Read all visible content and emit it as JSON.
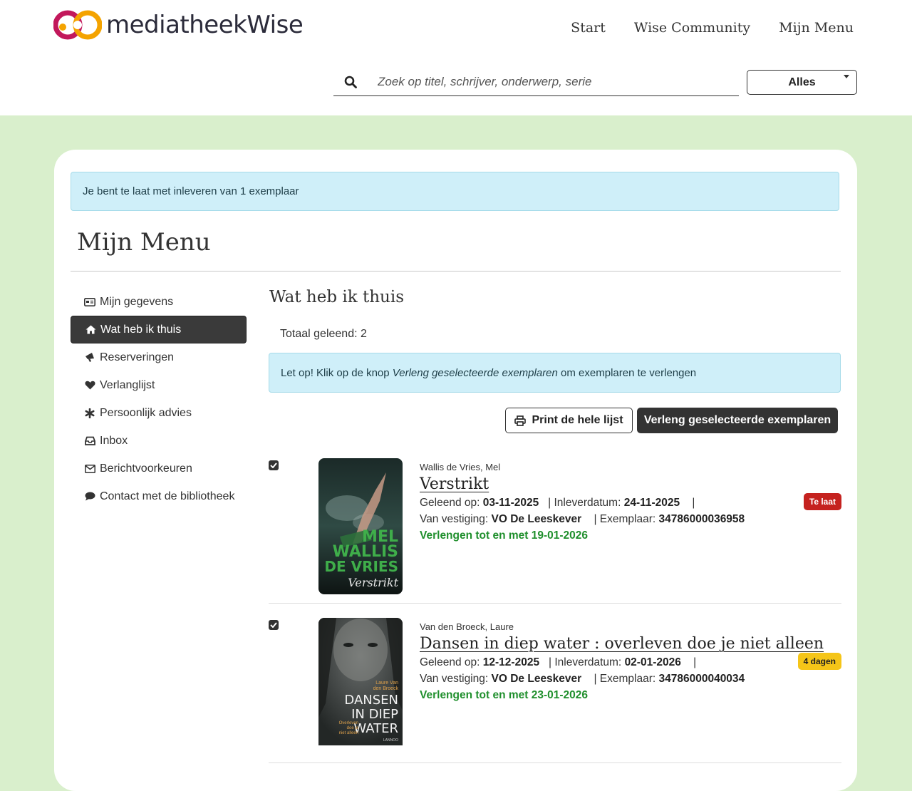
{
  "header": {
    "logo_text": "mediatheekWise",
    "nav": [
      "Start",
      "Wise Community",
      "Mijn Menu"
    ],
    "search_placeholder": "Zoek op titel, schrijver, onderwerp, serie",
    "filter_value": "Alles"
  },
  "alert_top": "Je bent te laat met inleveren van 1 exemplaar",
  "page_title": "Mijn Menu",
  "sidebar": [
    {
      "label": "Mijn gegevens",
      "icon": "id-card-icon"
    },
    {
      "label": "Wat heb ik thuis",
      "icon": "home-icon",
      "active": true
    },
    {
      "label": "Reserveringen",
      "icon": "bullhorn-icon"
    },
    {
      "label": "Verlanglijst",
      "icon": "heart-icon"
    },
    {
      "label": "Persoonlijk advies",
      "icon": "asterisk-icon"
    },
    {
      "label": "Inbox",
      "icon": "inbox-icon"
    },
    {
      "label": "Berichtvoorkeuren",
      "icon": "envelope-icon"
    },
    {
      "label": "Contact met de bibliotheek",
      "icon": "comment-icon"
    }
  ],
  "main": {
    "heading": "Wat heb ik thuis",
    "total_label": "Totaal geleend:",
    "total_value": "2",
    "info_prefix": "Let op! Klik op de knop ",
    "info_emph": "Verleng geselecteerde exemplaren",
    "info_suffix": " om exemplaren te verlengen",
    "print_label": "Print de hele lijst",
    "renew_label": "Verleng geselecteerde exemplaren"
  },
  "labels": {
    "loaned_on": "Geleend op:",
    "due_date": "| Inleverdatum:",
    "branch": "Van vestiging:",
    "copy": "| Exemplaar:",
    "pipe": "|"
  },
  "loans": [
    {
      "author": "Wallis de Vries, Mel",
      "title": "Verstrikt",
      "loaned_on": "03-11-2025",
      "due": "24-11-2025",
      "branch": "VO De Leeskever",
      "copy": "34786000036958",
      "renew": "Verlengen tot en met 19-01-2026",
      "badge": "Te laat",
      "badge_type": "late",
      "checked": true,
      "cover_text": [
        "MEL",
        "WALLIS",
        "DE VRIES",
        "Verstrikt"
      ]
    },
    {
      "author": "Van den Broeck, Laure",
      "title": "Dansen in diep water : overleven doe je niet alleen",
      "loaned_on": "12-12-2025",
      "due": "02-01-2026",
      "branch": "VO De Leeskever",
      "copy": "34786000040034",
      "renew": "Verlengen tot en met 23-01-2026",
      "badge": "4 dagen",
      "badge_type": "soon",
      "checked": true,
      "cover_text": [
        "Laure Van",
        "den Broeck",
        "DANSEN",
        "IN DIEP",
        "WATER",
        "Overleven",
        "doe je",
        "niet alleen",
        "LANNOO"
      ]
    }
  ],
  "colors": {
    "page_bg": "#d9efcc",
    "alert_bg": "#cfeff9",
    "active_nav": "#3a3a3a",
    "renew_green": "#1f8f2c",
    "late_red": "#c5221f",
    "soon_yellow": "#f5c518"
  }
}
